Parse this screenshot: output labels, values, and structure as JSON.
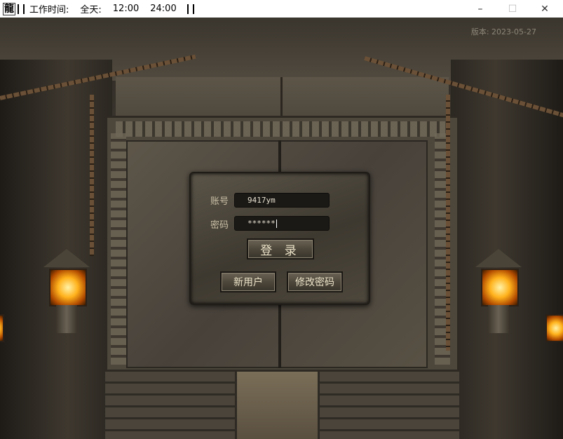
{
  "titlebar": {
    "app_icon": "龍",
    "work_hours_label": "工作时间:",
    "all_day": "全天:",
    "start_time": "12:00",
    "end_time": "24:00"
  },
  "window_controls": {
    "minimize": "–",
    "maximize": "☐",
    "close": "✕"
  },
  "version": "版本: 2023-05-27",
  "login": {
    "account_label": "账号",
    "account_value": "9417ym",
    "password_label": "密码",
    "password_value": "******",
    "login_button": "登 录",
    "new_user_button": "新用户",
    "change_password_button": "修改密码"
  }
}
